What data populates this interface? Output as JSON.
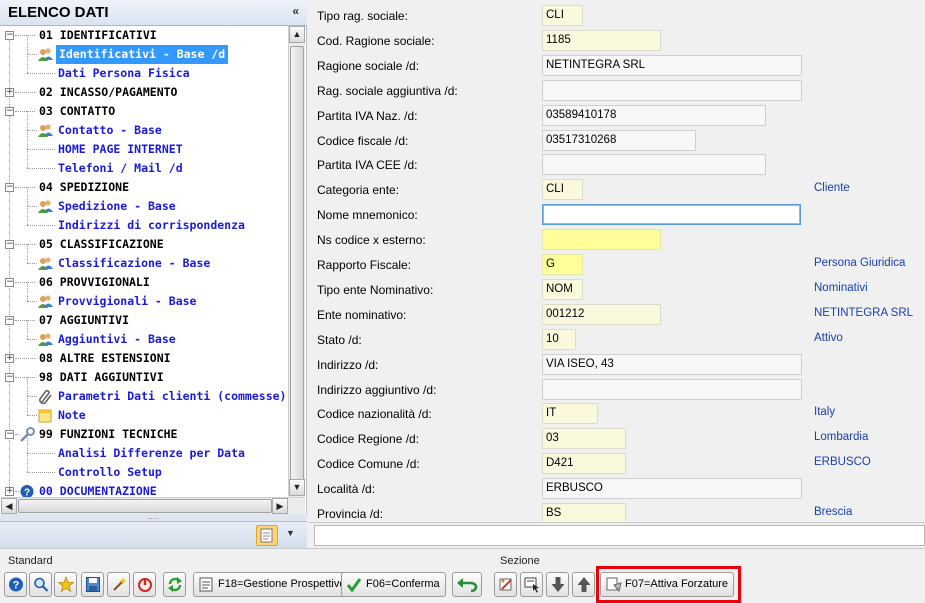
{
  "left_panel": {
    "title": "ELENCO DATI",
    "collapse_glyph": "«",
    "tree": [
      {
        "label": "01 IDENTIFICATIVI",
        "level": 1,
        "toggle": "−",
        "icon": ""
      },
      {
        "label": "Identificativi - Base /d",
        "level": 2,
        "icon": "users-icon",
        "selected": true
      },
      {
        "label": "Dati Persona Fisica",
        "level": 2,
        "icon": ""
      },
      {
        "label": "02 INCASSO/PAGAMENTO",
        "level": 1,
        "toggle": "+",
        "icon": ""
      },
      {
        "label": "03 CONTATTO",
        "level": 1,
        "toggle": "−",
        "icon": ""
      },
      {
        "label": "Contatto - Base",
        "level": 2,
        "icon": "users-icon"
      },
      {
        "label": "HOME PAGE INTERNET",
        "level": 2,
        "icon": ""
      },
      {
        "label": "Telefoni / Mail /d",
        "level": 2,
        "icon": ""
      },
      {
        "label": "04 SPEDIZIONE",
        "level": 1,
        "toggle": "−",
        "icon": ""
      },
      {
        "label": "Spedizione - Base",
        "level": 2,
        "icon": "users-icon"
      },
      {
        "label": "Indirizzi di corrispondenza",
        "level": 2,
        "icon": ""
      },
      {
        "label": "05 CLASSIFICAZIONE",
        "level": 1,
        "toggle": "−",
        "icon": ""
      },
      {
        "label": "Classificazione - Base",
        "level": 2,
        "icon": "users-icon"
      },
      {
        "label": "06 PROVVIGIONALI",
        "level": 1,
        "toggle": "−",
        "icon": ""
      },
      {
        "label": "Provvigionali - Base",
        "level": 2,
        "icon": "users-icon"
      },
      {
        "label": "07 AGGIUNTIVI",
        "level": 1,
        "toggle": "−",
        "icon": ""
      },
      {
        "label": "Aggiuntivi - Base",
        "level": 2,
        "icon": "users-icon"
      },
      {
        "label": "08 ALTRE ESTENSIONI",
        "level": 1,
        "toggle": "+",
        "icon": ""
      },
      {
        "label": "98 DATI AGGIUNTIVI",
        "level": 1,
        "toggle": "−",
        "icon": ""
      },
      {
        "label": "Parametri Dati clienti (commesse)",
        "level": 2,
        "icon": "paperclip-icon"
      },
      {
        "label": "Note",
        "level": 2,
        "icon": "note-icon"
      },
      {
        "label": "99 FUNZIONI TECNICHE",
        "level": 1,
        "toggle": "−",
        "icon": "wrench-icon"
      },
      {
        "label": "Analisi Differenze per Data",
        "level": 2,
        "icon": ""
      },
      {
        "label": "Controllo Setup",
        "level": 2,
        "icon": ""
      },
      {
        "label": "00 DOCUMENTAZIONE",
        "level": 1,
        "toggle": "+",
        "icon": "help-icon",
        "blue": true
      }
    ]
  },
  "form": {
    "fields": [
      {
        "label": "Tipo rag. sociale:",
        "value": "CLI",
        "style": "pale",
        "w": 41,
        "desc": ""
      },
      {
        "label": "Cod. Ragione sociale:",
        "value": "1185",
        "style": "pale",
        "w": 119,
        "desc": ""
      },
      {
        "label": "Ragione sociale /d:",
        "value": "NETINTEGRA SRL",
        "style": "grey",
        "w": 260,
        "desc": ""
      },
      {
        "label": "Rag. sociale aggiuntiva /d:",
        "value": "",
        "style": "grey",
        "w": 260,
        "desc": ""
      },
      {
        "label": "Partita IVA Naz. /d:",
        "value": "03589410178",
        "style": "grey",
        "w": 224,
        "desc": ""
      },
      {
        "label": "Codice fiscale /d:",
        "value": "03517310268",
        "style": "grey",
        "w": 154,
        "desc": ""
      },
      {
        "label": "Partita IVA CEE /d:",
        "value": "",
        "style": "grey",
        "w": 224,
        "desc": ""
      },
      {
        "label": "Categoria ente:",
        "value": "CLI",
        "style": "pale",
        "w": 41,
        "desc": "Cliente"
      },
      {
        "label": "Nome mnemonico:",
        "value": "",
        "style": "focus",
        "w": 259,
        "desc": ""
      },
      {
        "label": "Ns codice x esterno:",
        "value": "",
        "style": "yellow",
        "w": 119,
        "desc": ""
      },
      {
        "label": "Rapporto Fiscale:",
        "value": "G",
        "style": "yellow",
        "w": 41,
        "desc": "Persona Giuridica"
      },
      {
        "label": "Tipo ente Nominativo:",
        "value": "NOM",
        "style": "pale",
        "w": 41,
        "desc": "Nominativi"
      },
      {
        "label": "Ente nominativo:",
        "value": "001212",
        "style": "pale",
        "w": 119,
        "desc": "NETINTEGRA SRL"
      },
      {
        "label": "Stato /d:",
        "value": "10",
        "style": "pale",
        "w": 34,
        "desc": "Attivo"
      },
      {
        "label": "Indirizzo /d:",
        "value": "VIA ISEO, 43",
        "style": "grey",
        "w": 260,
        "desc": ""
      },
      {
        "label": "Indirizzo aggiuntivo /d:",
        "value": "",
        "style": "grey",
        "w": 260,
        "desc": ""
      },
      {
        "label": "Codice nazionalità /d:",
        "value": "IT",
        "style": "pale",
        "w": 56,
        "desc": "Italy"
      },
      {
        "label": "Codice Regione /d:",
        "value": "03",
        "style": "pale",
        "w": 84,
        "desc": "Lombardia"
      },
      {
        "label": "Codice Comune /d:",
        "value": "D421",
        "style": "pale",
        "w": 84,
        "desc": "ERBUSCO"
      },
      {
        "label": "Località /d:",
        "value": "ERBUSCO",
        "style": "grey",
        "w": 260,
        "desc": ""
      },
      {
        "label": "Provincia /d:",
        "value": "BS",
        "style": "pale",
        "w": 84,
        "desc": "Brescia"
      }
    ]
  },
  "toolbar": {
    "standard_label": "Standard",
    "sezione_label": "Sezione",
    "f18_label": "F18=Gestione Prospettive",
    "f06_label": "F06=Conferma",
    "f07_label": "F07=Attiva Forzature"
  },
  "colors": {
    "selection": "#3399ff",
    "link_blue": "#1a1adb",
    "desc_blue": "#1a3fae",
    "highlight_red": "#e8000b",
    "pale_field": "#fbf9dd",
    "yellow_field": "#ffff99"
  }
}
